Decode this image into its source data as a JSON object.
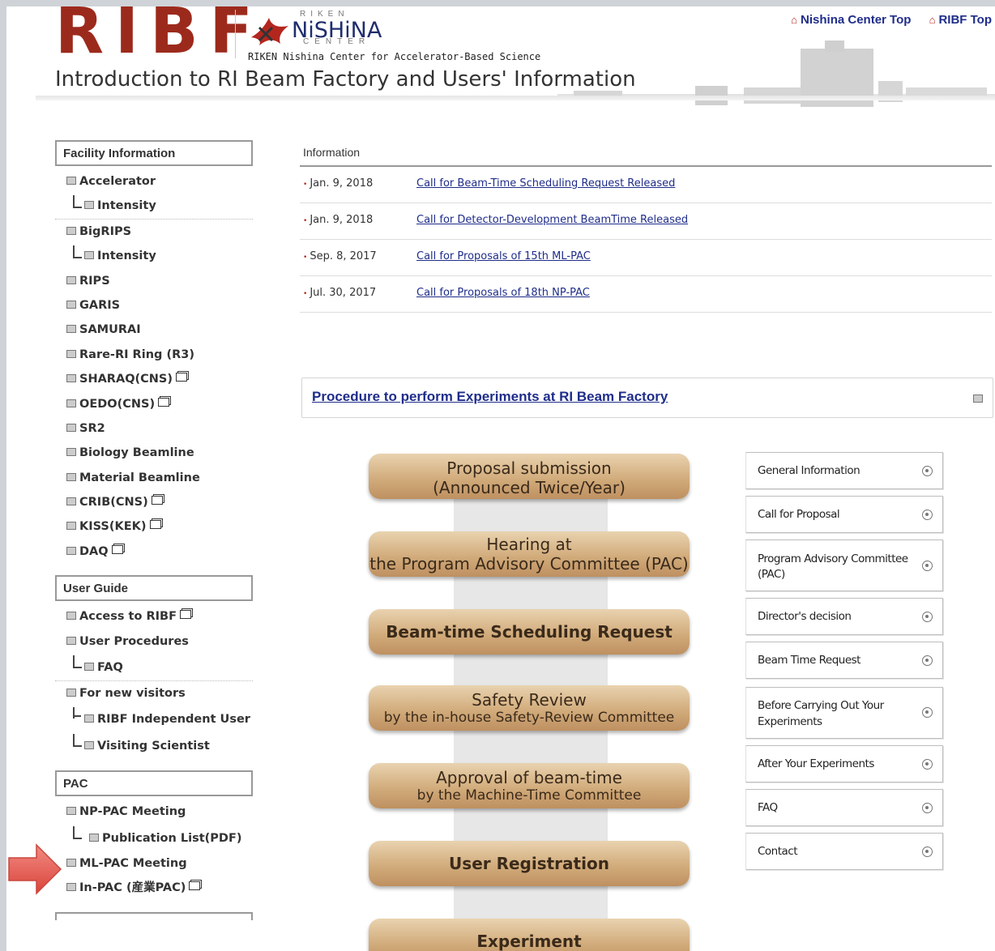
{
  "header": {
    "logo_text": "RIBF",
    "nishina_top": "RIKEN",
    "nishina_word": "NiSHiNA",
    "nishina_bottom": "CENTER",
    "nishina_subtitle": "RIKEN Nishina Center for Accelerator-Based Science",
    "title": "Introduction to RI Beam Factory and Users' Information",
    "links": [
      "Nishina Center Top",
      "RIBF Top"
    ]
  },
  "sidebar": {
    "sections": [
      {
        "heading": "Facility Information",
        "items": [
          {
            "label": "Accelerator",
            "level": 0
          },
          {
            "label": "Intensity",
            "level": 1
          },
          {
            "label": "BigRIPS",
            "level": 0
          },
          {
            "label": "Intensity",
            "level": 1
          },
          {
            "label": "RIPS",
            "level": 0
          },
          {
            "label": "GARIS",
            "level": 0
          },
          {
            "label": "SAMURAI",
            "level": 0
          },
          {
            "label": "Rare-RI Ring (R3)",
            "level": 0
          },
          {
            "label": "SHARAQ(CNS)",
            "level": 0,
            "ext": true
          },
          {
            "label": "OEDO(CNS)",
            "level": 0,
            "ext": true
          },
          {
            "label": "SR2",
            "level": 0
          },
          {
            "label": "Biology Beamline",
            "level": 0
          },
          {
            "label": "Material Beamline",
            "level": 0
          },
          {
            "label": "CRIB(CNS)",
            "level": 0,
            "ext": true
          },
          {
            "label": "KISS(KEK)",
            "level": 0,
            "ext": true
          },
          {
            "label": "DAQ",
            "level": 0,
            "ext": true
          }
        ]
      },
      {
        "heading": "User Guide",
        "items": [
          {
            "label": "Access to RIBF",
            "level": 0,
            "ext": true
          },
          {
            "label": "User Procedures",
            "level": 0
          },
          {
            "label": "FAQ",
            "level": 1
          },
          {
            "label": "For new visitors",
            "level": 0
          },
          {
            "label": "RIBF Independent User",
            "level": 1,
            "tee": true
          },
          {
            "label": "Visiting Scientist",
            "level": 1
          }
        ]
      },
      {
        "heading": "PAC",
        "items": [
          {
            "label": "NP-PAC Meeting",
            "level": 0
          },
          {
            "label": "Publication List(PDF)",
            "level": 1
          },
          {
            "label": "ML-PAC Meeting",
            "level": 0
          },
          {
            "label": "In-PAC (産業PAC)",
            "level": 0,
            "ext": true
          }
        ]
      }
    ]
  },
  "information": {
    "heading": "Information",
    "rows": [
      {
        "date": "Jan. 9, 2018",
        "title": "Call for Beam-Time Scheduling Request Released"
      },
      {
        "date": "Jan. 9, 2018",
        "title": "Call for Detector-Development BeamTime Released"
      },
      {
        "date": "Sep. 8, 2017",
        "title": "Call for Proposals of 15th ML-PAC"
      },
      {
        "date": "Jul. 30, 2017",
        "title": "Call for Proposals of 18th NP-PAC"
      }
    ]
  },
  "procedure": {
    "link": "Procedure to perform Experiments at RI Beam Factory"
  },
  "flow": [
    {
      "line1": "Proposal submission",
      "line2": "(Announced Twice/Year)"
    },
    {
      "line1": "Hearing at",
      "line2": "the Program Advisory Committee (PAC)"
    },
    {
      "line1": "Beam-time Scheduling Request",
      "line2": ""
    },
    {
      "line1": "Safety Review",
      "line2": "by the in-house Safety-Review Committee"
    },
    {
      "line1": "Approval of beam-time",
      "line2": "by the Machine-Time Committee"
    },
    {
      "line1": "User Registration",
      "line2": ""
    },
    {
      "line1": "Experiment",
      "line2": ""
    }
  ],
  "right_menu": [
    "General Information",
    "Call for Proposal",
    "Program Advisory Committee (PAC)",
    "Director's decision",
    "Beam Time Request",
    "Before Carrying Out Your Experiments",
    "After Your Experiments",
    "FAQ",
    "Contact"
  ],
  "colors": {
    "logo_red": "#9c2a1c",
    "link_blue": "#1f2d8a",
    "flow_tan": "#d2ac7c",
    "annotation_arrow": "#e0504a"
  },
  "annotation": {
    "icon": "red-arrow-icon"
  }
}
